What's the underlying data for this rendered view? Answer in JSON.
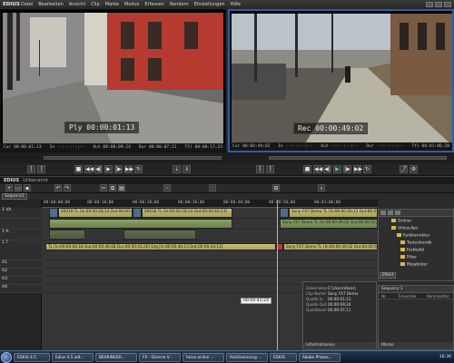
{
  "app": {
    "name": "EDIUS"
  },
  "menu": [
    "Datei",
    "Bearbeiten",
    "Ansicht",
    "Clip",
    "Marke",
    "Modus",
    "Erfassen",
    "Rendern",
    "Einstellungen",
    "Hilfe"
  ],
  "player": {
    "mode_label": "Ply",
    "timecode": "00:00:01:13",
    "cur": "Cur 00:00:01;13",
    "in": "In --:--:--;--",
    "out": "Out 00:00:09;24",
    "dur": "Dur 00:00:07;11",
    "ttl": "Ttl 00:00:17;23"
  },
  "recorder": {
    "mode_label": "Rec",
    "timecode": "00:00:49:02",
    "cur": "Cur 00:00:49;02",
    "in": "In --:--:--;--",
    "out": "Out --:--:--;--",
    "dur": "Dur --:--:--;--",
    "ttl": "Ttl 00:01:06;28"
  },
  "timeline": {
    "title": "EDIUS",
    "subtitle": "Unbenannt",
    "sequence_tab": "Sequenz1",
    "ruler": [
      "00:00:00;00",
      "00:00:10;00",
      "00:00:20;00",
      "00:00:30;00",
      "00:00:40;00",
      "00:00:50;00",
      "00:01:00;00",
      "00:01:10;00"
    ],
    "timecode_flag": "00:00:42;24",
    "tracks": [
      {
        "label": "1 VA"
      },
      {
        "label": "1 A"
      },
      {
        "label": "1 T"
      },
      {
        "label": "A1"
      },
      {
        "label": "A2"
      },
      {
        "label": "A3"
      },
      {
        "label": "A4"
      }
    ],
    "clips": [
      {
        "text": "00019  TL [In:00:00:28;14 Out:00:00:40;13 Dur:00:00:12;00]  Org [In:00:00:03;13 Out:00:00:09;24"
      },
      {
        "text": "00018  TL [In:00:00:28;14 Out:00:00:40;23]"
      },
      {
        "text": "Sony FX7 Demo  TL [In:00:00:50;13 Out:00:01:06;28]"
      },
      {
        "text": "Sony FX7 Demo  TL [In:00:00:49;02 Out:00:00:50;13]"
      },
      {
        "text": "TL [In:00:00:04;18 Out:00:00:46;08 Dur:00:00:41;20]  Org [In:00:00:40;13 Out:00:00:43;13]"
      },
      {
        "text": "Sony FX7 Demo  TL [In:00:00:49;02 Out:00:00:50;13]"
      }
    ]
  },
  "bin": {
    "folders": [
      "Ordner",
      "Videoclips",
      "Farbkorrektur",
      "Tastenkombi",
      "Farbtafel",
      "Filter",
      "Mojabilder"
    ],
    "effect_tab": "Effekt"
  },
  "info_panel": {
    "rows": [
      {
        "k": "Dateiname",
        "v": "C:\\Users\\Hans\\"
      },
      {
        "k": "Clip-Name",
        "v": "Sony FX7 Demo"
      },
      {
        "k": "Quelle In",
        "v": "00:00:01;13"
      },
      {
        "k": "Quelle Out",
        "v": "00:00:09;24"
      },
      {
        "k": "Quelldauer",
        "v": "00:00:07;11"
      }
    ],
    "footer": "Informationen"
  },
  "marker_panel": {
    "header": "Sequenz 1",
    "columns": [
      "Nr.",
      "Timecode",
      "Kommentar"
    ],
    "footer": "Marke"
  },
  "taskbar": {
    "tasks": [
      "EDIUS 4.5",
      "Edius 4.5 odt...",
      "BEHRINGER...",
      "FX - Diverse V...",
      "heise online ...",
      "Positionierung ...",
      "EDIUS",
      "Adobe Photos..."
    ],
    "clock": "16:36"
  }
}
